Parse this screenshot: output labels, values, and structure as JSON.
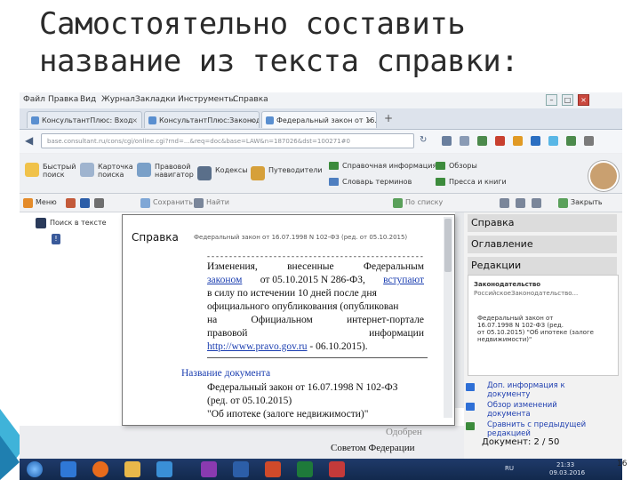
{
  "slide": {
    "title_line1": "Самостоятельно составить",
    "title_line2": "название из текста справки:",
    "page_number": "16"
  },
  "browser": {
    "menu": [
      "Файл",
      "Правка",
      "Вид",
      "Журнал",
      "Закладки",
      "Инструменты",
      "Справка"
    ],
    "tabs": [
      "КонсультантПлюс: Вход",
      "КонсультантПлюс:Законод...",
      "Федеральный закон от 16...."
    ],
    "url": "base.consultant.ru/cons/cgi/online.cgi?rnd=...&req=doc&base=LAW&n=187026&dst=100271#0"
  },
  "app_toolbar": {
    "buttons": [
      {
        "line1": "Быстрый",
        "line2": "поиск"
      },
      {
        "line1": "Карточка",
        "line2": "поиска"
      },
      {
        "line1": "Правовой",
        "line2": "навигатор"
      },
      {
        "line1": "Кодексы",
        "line2": ""
      },
      {
        "line1": "Путеводители",
        "line2": ""
      }
    ],
    "links": [
      "Справочная информация",
      "Словарь терминов",
      "Обзоры",
      "Пресса и книги"
    ]
  },
  "doc_toolbar": {
    "menu_label": "Меню",
    "word_label": "",
    "save_label": "Сохранить",
    "find_label": "Найти",
    "scope_label": "По списку",
    "back_label": "Закрыть"
  },
  "left_pane": {
    "search_label": "Поиск в тексте"
  },
  "right_pane": {
    "items": [
      "Справка",
      "Оглавление",
      "Редакции"
    ],
    "box_title": "Законодательство",
    "box_subtitle": "РоссийскоеЗаконодательство...",
    "box_text": [
      "Федеральный закон от",
      "16.07.1998 N 102-ФЗ (ред.",
      "от 05.10.2015) \"Об ипотеке (залоге",
      "недвижимости)\""
    ],
    "links": [
      [
        "Доп. информация к",
        "документу"
      ],
      [
        "Обзор изменений",
        "документа"
      ],
      [
        "Сравнить с предыдущей",
        "редакцией"
      ]
    ],
    "doc_counter": "Документ: 2 / 50"
  },
  "reference_popup": {
    "title": "Справка",
    "header": "Федеральный закон от 16.07.1998 N 102-ФЗ (ред. от 05.10.2015)",
    "dash_line": "--------------------------------------------------------------",
    "body_lines": [
      [
        "Изменения,",
        "внесенные",
        "Федеральным"
      ],
      [
        "законом",
        "от 05.10.2015 N 286-ФЗ,",
        "вступают"
      ],
      [
        "в силу по истечении 10 дней после дня"
      ],
      [
        "официального опубликования (опубликован"
      ],
      [
        "на",
        "Официальном",
        "интернет-портале"
      ],
      [
        "правовой",
        "информации"
      ],
      [
        "http://www.pravo.gov.ru",
        "- 06.10.2015)."
      ]
    ],
    "section_title": "Название документа",
    "doc_lines": [
      "Федеральный закон от 16.07.1998 N 102-ФЗ",
      "(ред. от 05.10.2015)",
      "\"Об ипотеке (залоге недвижимости)\""
    ]
  },
  "background_doc": {
    "line1": "Одобрен",
    "line2": "Советом Федерации"
  },
  "taskbar": {
    "lang": "RU",
    "time": "21:33",
    "date": "09.03.2016"
  }
}
